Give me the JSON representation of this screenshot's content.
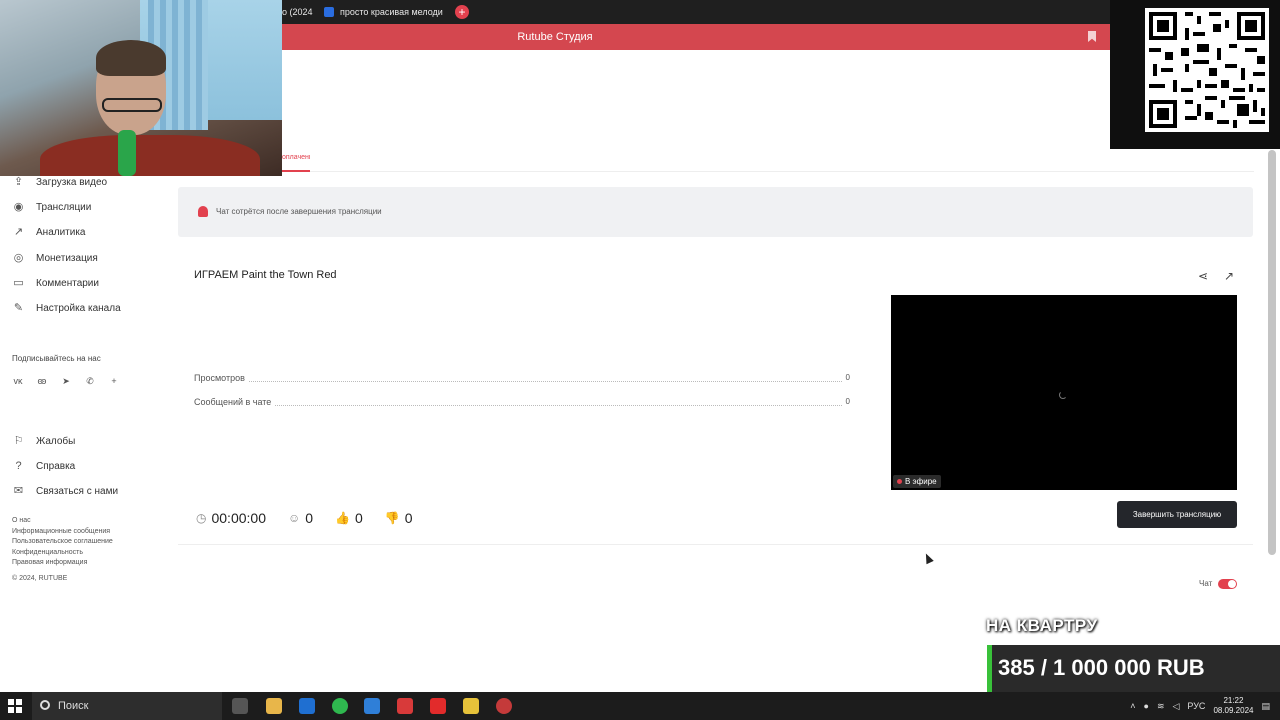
{
  "browser": {
    "tab1_title": "о (2024",
    "tab2_title": "просто красивая мелоди",
    "new_tab": "+"
  },
  "banner": {
    "title": "Rutube Студия"
  },
  "studio": {
    "active_tab": "оплачение"
  },
  "sidebar": {
    "items": [
      {
        "label": "Загрузка видео",
        "icon": "upload-icon"
      },
      {
        "label": "Трансляции",
        "icon": "broadcast-icon"
      },
      {
        "label": "Аналитика",
        "icon": "analytics-icon"
      },
      {
        "label": "Монетизация",
        "icon": "monetization-icon"
      },
      {
        "label": "Комментарии",
        "icon": "comments-icon"
      },
      {
        "label": "Настройка канала",
        "icon": "settings-icon"
      }
    ],
    "follow_label": "Подписывайтесь на нас",
    "social_icons": [
      "vk-icon",
      "ok-icon",
      "telegram-icon",
      "viber-icon",
      "plus-icon"
    ],
    "support_items": [
      {
        "label": "Жалобы",
        "icon": "complaints-icon"
      },
      {
        "label": "Справка",
        "icon": "help-icon"
      },
      {
        "label": "Связаться с нами",
        "icon": "contact-icon"
      }
    ],
    "legal_links": [
      "О нас",
      "Информационные сообщения",
      "Пользовательское соглашение",
      "Конфиденциальность",
      "Правовая информация"
    ],
    "copyright": "© 2024, RUTUBE"
  },
  "notice": {
    "text": "Чат сотрётся после завершения трансляции"
  },
  "stream": {
    "title": "ИГРАЕМ Paint the Town Red",
    "stats": [
      {
        "label": "Просмотров",
        "value": "0"
      },
      {
        "label": "Сообщений в чате",
        "value": "0"
      }
    ],
    "live_badge": "В эфире",
    "timer": "00:00:00",
    "viewers": "0",
    "likes": "0",
    "dislikes": "0",
    "end_button": "Завершить трансляцию"
  },
  "chat": {
    "label": "Чат",
    "enabled": true
  },
  "overlay": {
    "goal_title": "НА КВАРТРУ",
    "goal_text": "385 / 1 000 000 RUB"
  },
  "taskbar": {
    "search_label": "Поиск",
    "language": "РУС",
    "time": "21:22",
    "date": "08.09.2024"
  },
  "colors": {
    "accent": "#e2414e",
    "banner": "#d4474f",
    "dark_button": "#24262b",
    "goal_green": "#39c13a"
  }
}
